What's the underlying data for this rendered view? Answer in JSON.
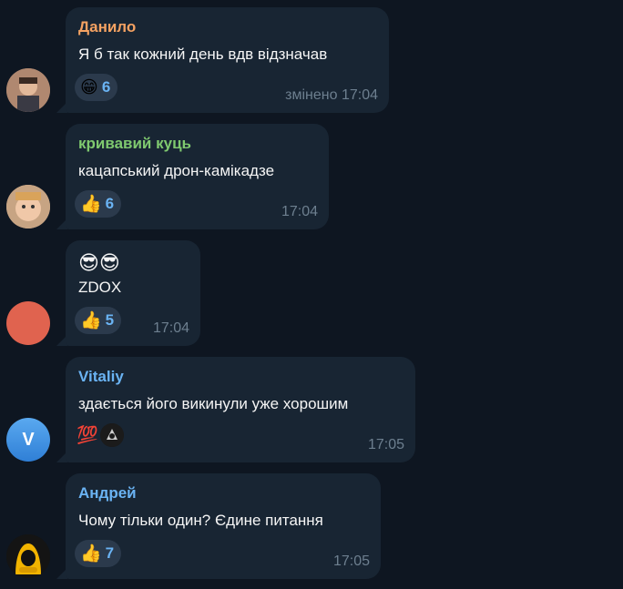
{
  "messages": [
    {
      "sender": "Данило",
      "sender_color": "#f5a262",
      "text": "Я б так кожний день вдв відзначав",
      "reaction": {
        "emoji": "😁",
        "count": "6"
      },
      "time": "змінено 17:04"
    },
    {
      "sender": "кривавий куць",
      "sender_color": "#7fc96f",
      "text": "кацапський дрон-камікадзе",
      "reaction": {
        "emoji": "👍",
        "count": "6"
      },
      "time": "17:04"
    },
    {
      "sender": "",
      "text": "😎😎",
      "text2": "ZDOX",
      "reaction": {
        "emoji": "👍",
        "count": "5"
      },
      "time": "17:04",
      "avatar_color": "#e0634f"
    },
    {
      "sender": "Vitaliy",
      "sender_color": "#6ab3f3",
      "text": "здається його викинули уже хорошим",
      "reaction": {
        "emoji": "💯",
        "count": ""
      },
      "time": "17:05",
      "avatar_letter": "V",
      "avatar_color": "#3d8fe0"
    },
    {
      "sender": "Андрей",
      "sender_color": "#6ab3f3",
      "text": "Чому тільки один? Єдине питання",
      "reaction": {
        "emoji": "👍",
        "count": "7"
      },
      "time": "17:05"
    }
  ]
}
